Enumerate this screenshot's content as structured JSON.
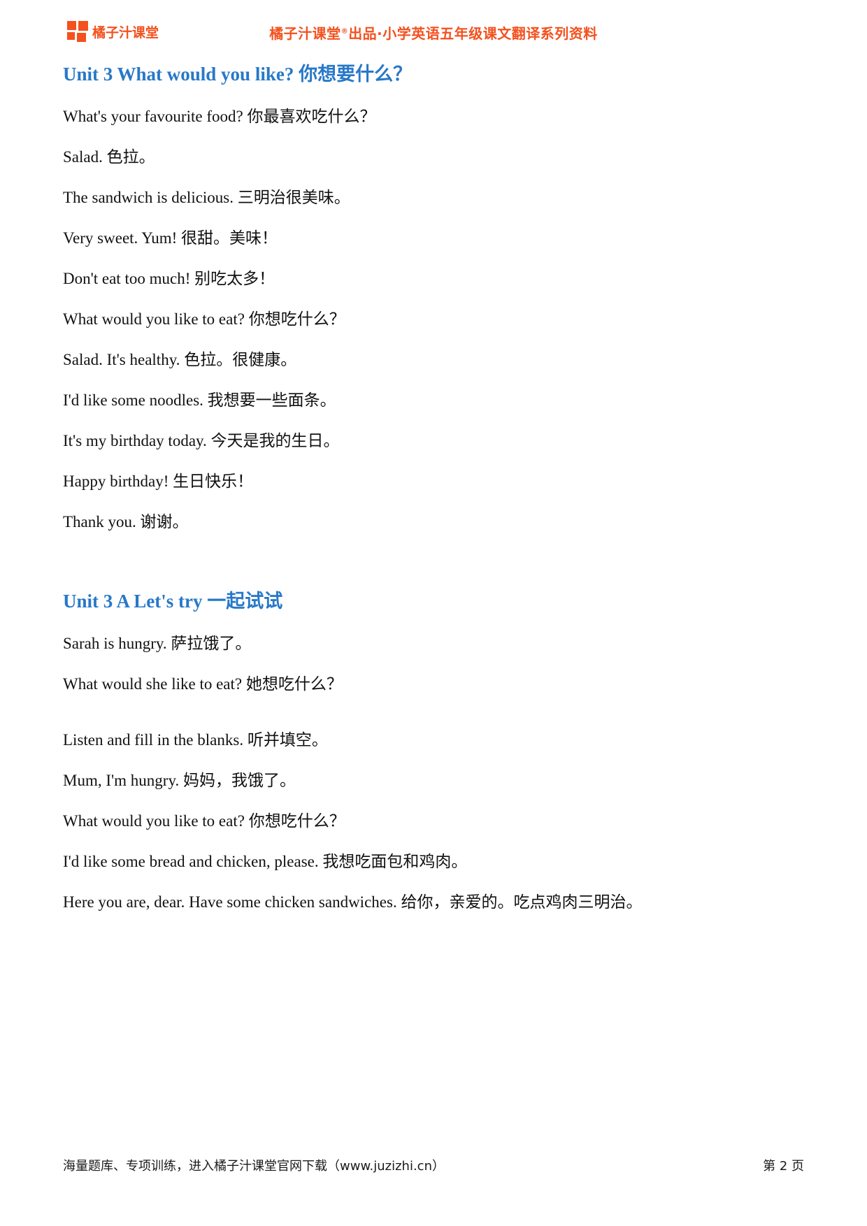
{
  "header": {
    "brand_name": "橘子汁课堂",
    "title_prefix": "橘子汁课堂",
    "title_reg_mark": "®",
    "title_suffix": "出品·小学英语五年级课文翻译系列资料",
    "brand_color": "#f4511e"
  },
  "sections": [
    {
      "heading": "Unit 3 What would you like? 你想要什么？",
      "heading_color": "#2878c8",
      "lines": [
        "What's your favourite food? 你最喜欢吃什么？",
        "Salad. 色拉。",
        "The sandwich is delicious. 三明治很美味。",
        "Very sweet. Yum! 很甜。美味！",
        "Don't eat too much! 别吃太多！",
        "What would you like to eat? 你想吃什么？",
        "Salad. It's healthy. 色拉。很健康。",
        "I'd like some noodles. 我想要一些面条。",
        "It's my birthday today. 今天是我的生日。",
        "Happy birthday! 生日快乐！",
        "Thank you. 谢谢。"
      ]
    },
    {
      "heading": "Unit 3 A Let's try  一起试试",
      "heading_color": "#2878c8",
      "lines": [
        "Sarah is hungry. 萨拉饿了。",
        "What would she like to eat? 她想吃什么？"
      ]
    },
    {
      "heading": "",
      "heading_color": "#2878c8",
      "lines": [
        "Listen and fill in the blanks. 听并填空。",
        "Mum, I'm hungry. 妈妈，我饿了。",
        "What would you like to eat? 你想吃什么？",
        "I'd like some bread and chicken, please.  我想吃面包和鸡肉。",
        "Here you are, dear. Have some chicken sandwiches. 给你，亲爱的。吃点鸡肉三明治。"
      ]
    }
  ],
  "footer": {
    "note": "海量题库、专项训练，进入橘子汁课堂官网下载（www.juzizhi.cn）",
    "page_label": "第 2 页"
  }
}
